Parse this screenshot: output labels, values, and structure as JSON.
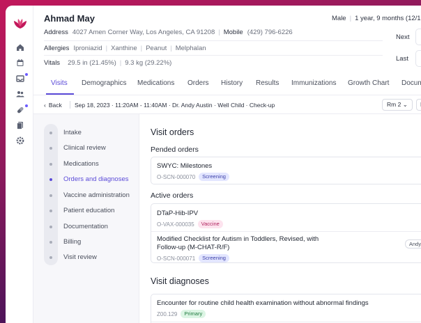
{
  "patient": {
    "name": "Ahmad May",
    "sex": "Male",
    "age_dob": "1 year, 9 months (12/15/",
    "address_label": "Address",
    "address": "4027 Amen Corner Way, Los Angeles, CA 91208",
    "mobile_label": "Mobile",
    "mobile": "(429) 796-6226",
    "allergies_label": "Allergies",
    "allergies": [
      "Iproniazid",
      "Xanthine",
      "Peanut",
      "Melphalan"
    ],
    "vitals_label": "Vitals",
    "vitals": [
      "29.5 in (21.45%)",
      "9.3 kg (29.22%)"
    ],
    "next_label": "Next",
    "last_label": "Last"
  },
  "tabs": [
    "Visits",
    "Demographics",
    "Medications",
    "Orders",
    "History",
    "Results",
    "Immunizations",
    "Growth Chart",
    "Docum"
  ],
  "active_tab": "Visits",
  "crumb": {
    "back": "Back",
    "info": "Sep 18, 2023 · 11:20AM - 11:40AM · Dr. Andy Austin · Well Child · Check-up",
    "room": "Rm 2",
    "edge_button": "E"
  },
  "steps": [
    "Intake",
    "Clinical review",
    "Medications",
    "Orders and diagnoses",
    "Vaccine administration",
    "Patient education",
    "Documentation",
    "Billing",
    "Visit review"
  ],
  "active_step": "Orders and diagnoses",
  "visit_orders": {
    "title": "Visit orders",
    "pended_title": "Pended orders",
    "pended": [
      {
        "title": "SWYC: Milestones",
        "code": "O-SCN-000070",
        "tag": "Screening"
      }
    ],
    "active_title": "Active orders",
    "active": [
      {
        "title": "DTaP-Hib-IPV",
        "code": "O-VAX-000035",
        "tag": "Vaccine"
      },
      {
        "title": "Modified Checklist for Autism in Toddlers, Revised, with Follow-up (M-CHAT-R/F)",
        "code": "O-SCN-000071",
        "tag": "Screening",
        "assignee": "Andy"
      }
    ]
  },
  "visit_diagnoses": {
    "title": "Visit diagnoses",
    "items": [
      {
        "title": "Encounter for routine child health examination without abnormal findings",
        "code": "Z00.129",
        "tag": "Primary"
      }
    ]
  },
  "colors": {
    "accent": "#5b4bd8",
    "screening_pill": "#e3e6ff",
    "vaccine_pill": "#fde3ee",
    "primary_pill": "#dcf5e4",
    "background_gradient_start": "#c2185b",
    "background_gradient_end": "#2b1248"
  },
  "rail_icons": [
    "lotus-logo-icon",
    "home-icon",
    "calendar-icon",
    "inbox-icon",
    "patients-icon",
    "medication-icon",
    "documents-icon",
    "settings-icon"
  ]
}
